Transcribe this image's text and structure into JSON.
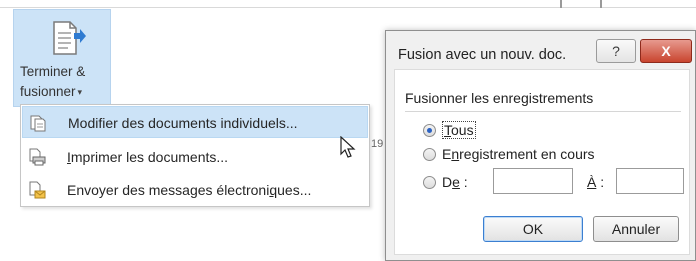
{
  "ribbon": {
    "finish_merge": {
      "label_line1": "Terminer &",
      "label_line2": "fusionner",
      "caret": "▾",
      "icon": "merge-document-icon"
    }
  },
  "menu": {
    "items": [
      {
        "label": "Modifier des documents individuels...",
        "icon": "edit-documents-icon",
        "highlighted": true
      },
      {
        "label_underlined": "I",
        "label_rest": "mprimer les documents...",
        "icon": "print-documents-icon"
      },
      {
        "label_pre": "Envoyer des messages électroni",
        "label_underlined": "q",
        "label_post": "ues...",
        "icon": "email-messages-icon"
      }
    ]
  },
  "stray_text": "19",
  "dialog": {
    "title": "Fusion avec un nouv. doc.",
    "help_label": "?",
    "close_label": "X",
    "group_title": "Fusionner les enregistrements",
    "options": {
      "all_underlined": "T",
      "all_rest": "ous",
      "current_underlined": "n",
      "current_pre": "E",
      "current_rest": "registrement en cours",
      "from_pre": "D",
      "from_underlined": "e",
      "from_post": " :",
      "to_underlined": "À",
      "to_post": " :"
    },
    "from_value": "",
    "to_value": "",
    "ok_label": "OK",
    "cancel_label": "Annuler"
  }
}
